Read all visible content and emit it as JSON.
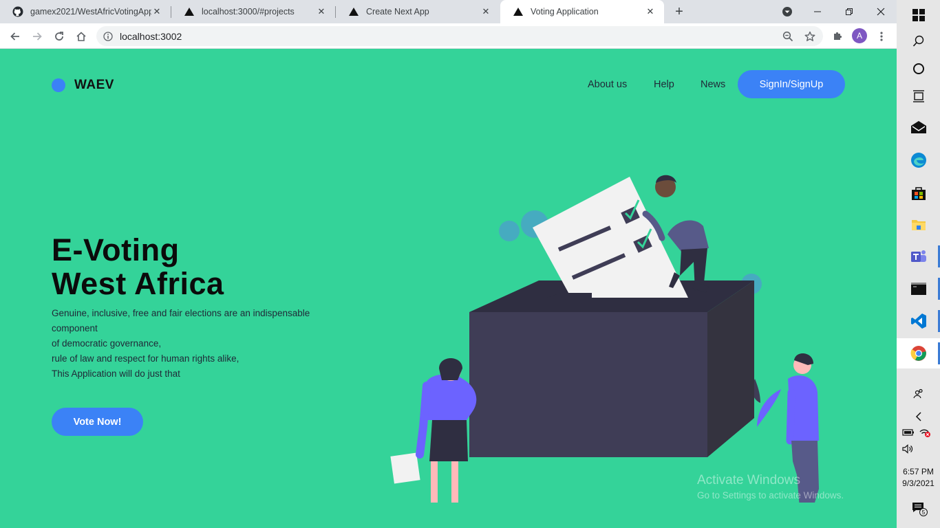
{
  "browser": {
    "tabs": [
      {
        "title": "gamex2021/WestAfricVotingApp",
        "icon": "github-icon"
      },
      {
        "title": "localhost:3000/#projects",
        "icon": "vercel-triangle-icon"
      },
      {
        "title": "Create Next App",
        "icon": "vercel-triangle-icon"
      },
      {
        "title": "Voting Application",
        "icon": "vercel-triangle-icon",
        "active": true
      }
    ],
    "url": "localhost:3002",
    "profile_initial": "A"
  },
  "page": {
    "brand": "WAEV",
    "nav": [
      "About us",
      "Help",
      "News"
    ],
    "signin_label": "SignIn/SignUp",
    "hero_title_line1": "E-Voting",
    "hero_title_line2": "West Africa",
    "hero_lines": [
      "Genuine, inclusive, free and fair elections are an indispensable component",
      "of democratic governance,",
      "rule of law and respect for human rights alike,",
      "This Application will do just that"
    ],
    "vote_button": "Vote Now!",
    "colors": {
      "background": "#34d399",
      "accent": "#3b82f6",
      "box": "#3f3d56",
      "figure_shirt": "#6c63ff"
    }
  },
  "watermark": {
    "line1": "Activate Windows",
    "line2": "Go to Settings to activate Windows."
  },
  "taskbar": {
    "icons": [
      "windows-start-icon",
      "search-icon",
      "cortana-icon",
      "task-view-icon",
      "mail-icon",
      "edge-icon",
      "store-icon",
      "file-explorer-icon",
      "teams-icon",
      "terminal-icon",
      "vscode-icon",
      "chrome-icon"
    ],
    "tray_icons": [
      "people-icon",
      "show-hidden-icon",
      "battery-icon",
      "network-icon",
      "volume-icon",
      "notifications-icon"
    ],
    "time": "6:57 PM",
    "date": "9/3/2021",
    "notification_count": "5"
  }
}
